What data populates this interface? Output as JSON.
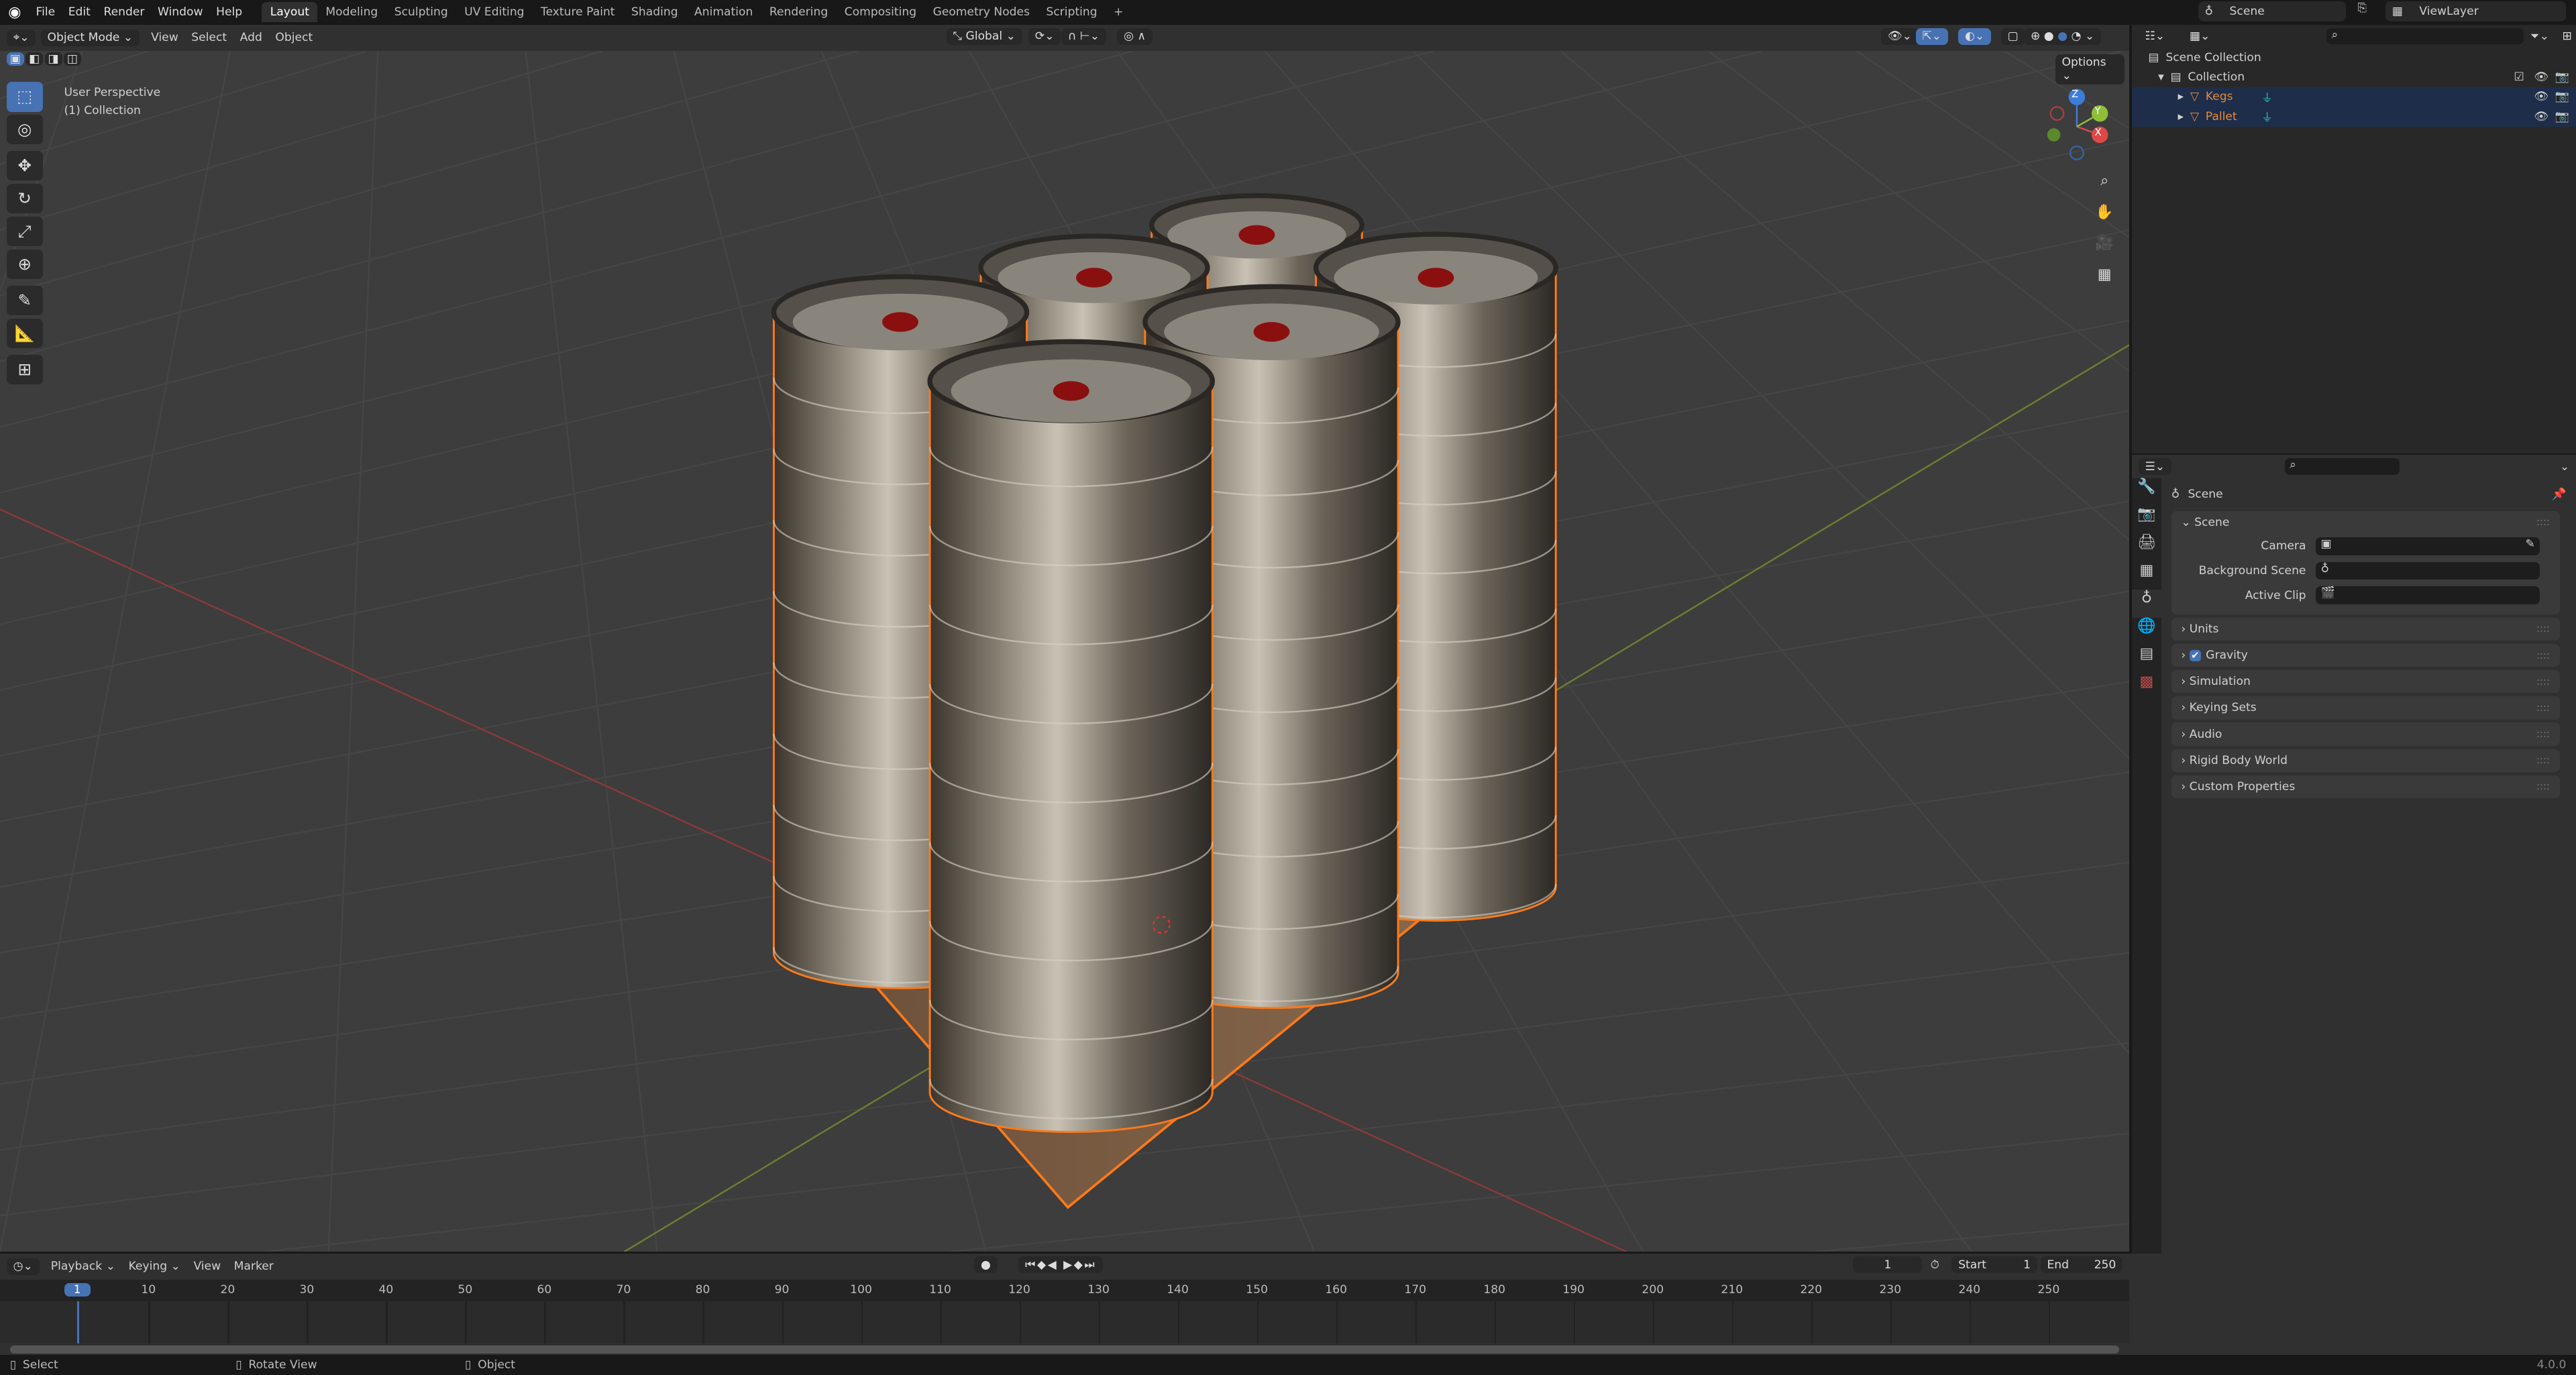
{
  "menubar": {
    "items": [
      "File",
      "Edit",
      "Render",
      "Window",
      "Help"
    ],
    "workspaces": [
      "Layout",
      "Modeling",
      "Sculpting",
      "UV Editing",
      "Texture Paint",
      "Shading",
      "Animation",
      "Rendering",
      "Compositing",
      "Geometry Nodes",
      "Scripting"
    ],
    "active_workspace": "Layout",
    "add_workspace": "+",
    "scene": "Scene",
    "view_layer": "ViewLayer"
  },
  "viewport_header": {
    "mode": "Object Mode",
    "menus": [
      "View",
      "Select",
      "Add",
      "Object"
    ],
    "transform_orientation": "Global",
    "options": "Options"
  },
  "viewport": {
    "perspective": "User Perspective",
    "collection": "(1) Collection",
    "axes": {
      "x": "X",
      "y": "Y",
      "z": "Z"
    }
  },
  "toolbar": {
    "tools": [
      "select-box",
      "cursor",
      "move",
      "rotate",
      "scale",
      "transform",
      "annotate",
      "measure",
      "add-cube"
    ]
  },
  "outliner": {
    "root": "Scene Collection",
    "collection": "Collection",
    "objects": [
      {
        "name": "Kegs"
      },
      {
        "name": "Pallet"
      }
    ],
    "object_color": "#e8883a"
  },
  "properties": {
    "context": "Scene",
    "sections": {
      "scene": "Scene",
      "camera_label": "Camera",
      "background_label": "Background Scene",
      "clip_label": "Active Clip"
    },
    "panels": [
      "Units",
      "Gravity",
      "Simulation",
      "Keying Sets",
      "Audio",
      "Rigid Body World",
      "Custom Properties"
    ],
    "gravity_checked": true
  },
  "timeline": {
    "menus": [
      "Playback",
      "Keying",
      "View",
      "Marker"
    ],
    "current_frame": "1",
    "start_label": "Start",
    "start": "1",
    "end_label": "End",
    "end": "250",
    "ticks": [
      "1",
      "10",
      "20",
      "30",
      "40",
      "50",
      "60",
      "70",
      "80",
      "90",
      "100",
      "110",
      "120",
      "130",
      "140",
      "150",
      "160",
      "170",
      "180",
      "190",
      "200",
      "210",
      "220",
      "230",
      "240",
      "250"
    ]
  },
  "statusbar": {
    "select": "Select",
    "rotate": "Rotate View",
    "object": "Object",
    "version": "4.0.0"
  }
}
